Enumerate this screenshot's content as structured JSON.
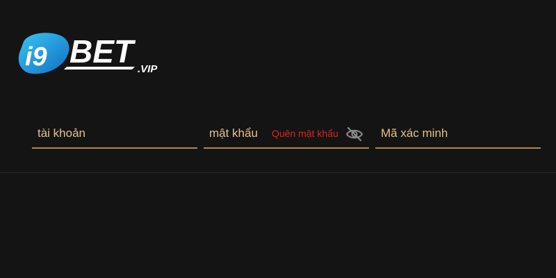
{
  "brand": {
    "logo_text": "i9BET.VIP",
    "colors": {
      "accent_gold": "#b4884a",
      "field_text": "#e6c08a",
      "link_red": "#e0241b",
      "logo_blue": "#1aa3e6",
      "background": "#141414"
    }
  },
  "login": {
    "username": {
      "placeholder": "tài khoản",
      "value": ""
    },
    "password": {
      "placeholder": "mật khẩu",
      "value": "",
      "forgot_label": "Quên mật khẩu",
      "visibility_icon": "eye-off-icon"
    },
    "captcha": {
      "placeholder": "Mã xác minh",
      "value": ""
    }
  }
}
